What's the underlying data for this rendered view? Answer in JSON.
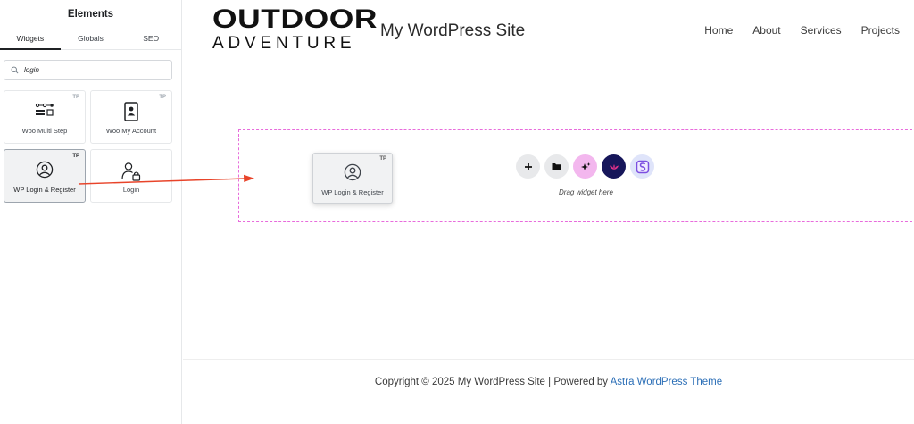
{
  "panel": {
    "title": "Elements",
    "tabs": [
      {
        "label": "Widgets",
        "active": true
      },
      {
        "label": "Globals",
        "active": false
      },
      {
        "label": "SEO",
        "active": false
      }
    ],
    "search": {
      "value": "login",
      "icon": "search-icon"
    },
    "widgets": [
      {
        "label": "Woo Multi Step",
        "badge": "TP",
        "icon": "multi-step-icon"
      },
      {
        "label": "Woo My Account",
        "badge": "TP",
        "icon": "account-card-icon"
      },
      {
        "label": "WP Login & Register",
        "badge": "TP",
        "icon": "user-circle-icon",
        "selected": true
      },
      {
        "label": "Login",
        "badge": "",
        "icon": "user-lock-icon"
      }
    ],
    "collapse_icon": "chevron-left-icon"
  },
  "site": {
    "logo_line1": "OUTDOOR",
    "logo_line2": "ADVENTURE",
    "title": "My WordPress Site",
    "nav": [
      "Home",
      "About",
      "Services",
      "Projects"
    ]
  },
  "canvas": {
    "drop_text": "Drag widget here",
    "drop_buttons": [
      "plus-icon",
      "folder-icon",
      "sparkle-icon",
      "lotus-icon",
      "s-logo-icon"
    ],
    "dragged_widget": {
      "label": "WP Login & Register",
      "badge": "TP"
    }
  },
  "footer": {
    "copyright_prefix": "Copyright © 2025 My WordPress Site | Powered by ",
    "link_text": "Astra WordPress Theme"
  },
  "colors": {
    "accent_dashed": "#e86bdc",
    "arrow": "#e8442a",
    "link": "#2c6fb7"
  }
}
